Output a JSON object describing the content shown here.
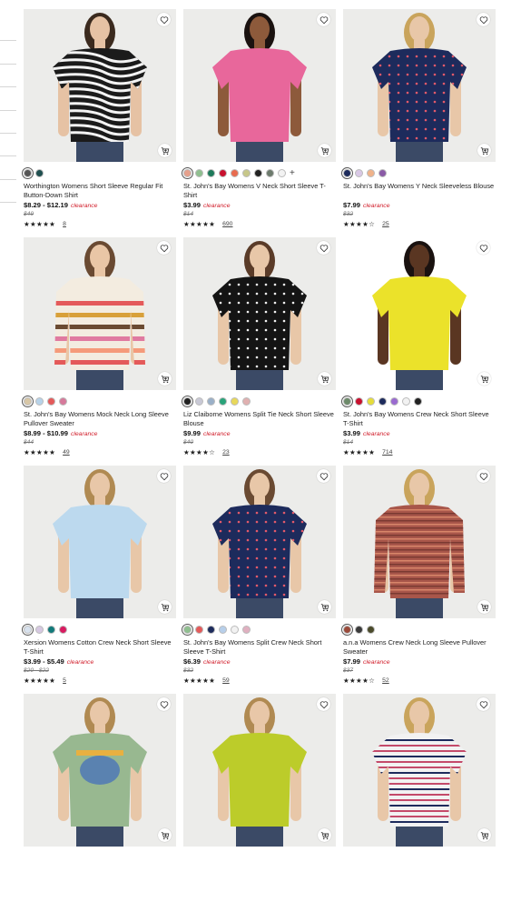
{
  "products": [
    {
      "title": "Worthington Womens Short Sleeve Regular Fit Button-Down Shirt",
      "price": "$8.29 - $12.19",
      "price_label": "clearance",
      "original_price": "$49",
      "reviews": "8",
      "rating": 4.5,
      "swatches": [
        "#555555",
        "#1f4f4f"
      ],
      "image": {
        "bg": "#ececea",
        "garment": "#1b1b1b",
        "pattern": "zebra",
        "skin": "#e6c2a4",
        "hair": "#3b2a1e"
      }
    },
    {
      "title": "St. John's Bay Womens V Neck Short Sleeve T-Shirt",
      "price": "$3.99",
      "price_label": "clearance",
      "original_price": "$14",
      "reviews": "690",
      "rating": 4.5,
      "swatches": [
        "#e6a08c",
        "#8fbf8f",
        "#1e7a5a",
        "#c8102e",
        "#e86b4f",
        "#c7c789",
        "#222222",
        "#6d7b6d",
        "#f2f2f2"
      ],
      "more_swatches": "+",
      "image": {
        "bg": "#ececea",
        "garment": "#e8679b",
        "pattern": "solid",
        "skin": "#8d5a3b",
        "hair": "#1a1210"
      }
    },
    {
      "title": "St. John's Bay Womens Y Neck Sleeveless Blouse",
      "price": "$7.99",
      "price_label": "clearance",
      "original_price": "$32",
      "reviews": "25",
      "rating": 4,
      "swatches": [
        "#1d2b5c",
        "#d9c8e6",
        "#f0b38a",
        "#8a5aa6"
      ],
      "image": {
        "bg": "#ececea",
        "garment": "#1d2b5c",
        "pattern": "dots",
        "skin": "#e8c7a8",
        "hair": "#c9a45c"
      }
    },
    {
      "title": "St. John's Bay Womens Mock Neck Long Sleeve Pullover Sweater",
      "price": "$8.99 - $10.99",
      "price_label": "clearance",
      "original_price": "$44",
      "reviews": "49",
      "rating": 4.5,
      "swatches": [
        "#d8c7a6",
        "#b7d3ea",
        "#e45a5a",
        "#d67a9b"
      ],
      "image": {
        "bg": "#ececea",
        "garment": "#f3ece0",
        "pattern": "stripes",
        "skin": "#e9c6a6",
        "hair": "#6a4a32"
      }
    },
    {
      "title": "Liz Claiborne Womens Split Tie Neck Short Sleeve Blouse",
      "price": "$9.99",
      "price_label": "clearance",
      "original_price": "$40",
      "reviews": "23",
      "rating": 4,
      "swatches": [
        "#222222",
        "#c9c9d6",
        "#9ab0c8",
        "#2aa37a",
        "#e8d85a",
        "#e0b0b0"
      ],
      "image": {
        "bg": "#ececea",
        "garment": "#141414",
        "pattern": "dots-white",
        "skin": "#e8c7a8",
        "hair": "#5a3b28"
      }
    },
    {
      "title": "St. John's Bay Womens Crew Neck Short Sleeve T-Shirt",
      "price": "$3.99",
      "price_label": "clearance",
      "original_price": "$14",
      "reviews": "714",
      "rating": 4.5,
      "swatches": [
        "#6d8a6a",
        "#c8102e",
        "#e6dd3a",
        "#1d2b5c",
        "#9a6ad0",
        "#f2f2f2",
        "#222222"
      ],
      "image": {
        "bg": "#ffffff",
        "garment": "#ebe22a",
        "pattern": "solid",
        "skin": "#5a3622",
        "hair": "#1a1210"
      }
    },
    {
      "title": "Xersion Womens Cotton Crew Neck Short Sleeve T-Shirt",
      "price": "$3.99 - $5.49",
      "price_label": "clearance",
      "original_price": "$20 - $22",
      "reviews": "5",
      "rating": 5,
      "swatches": [
        "#d8e2ee",
        "#d6c8e2",
        "#117a7a",
        "#d81b60"
      ],
      "image": {
        "bg": "#ececea",
        "garment": "#bcd9ee",
        "pattern": "solid",
        "skin": "#e8c7a8",
        "hair": "#b08a52"
      }
    },
    {
      "title": "St. John's Bay Womens Split Crew Neck Short Sleeve T-Shirt",
      "price": "$6.39",
      "price_label": "clearance",
      "original_price": "$32",
      "reviews": "59",
      "rating": 4.5,
      "swatches": [
        "#8fbf8f",
        "#e45a5a",
        "#1d2b5c",
        "#b7cfea",
        "#f2f2f2",
        "#e0b0c0"
      ],
      "image": {
        "bg": "#ececea",
        "garment": "#1d2b5c",
        "pattern": "dots",
        "skin": "#e8c7a8",
        "hair": "#6a4a32"
      }
    },
    {
      "title": "a.n.a Womens Crew Neck Long Sleeve Pullover Sweater",
      "price": "$7.99",
      "price_label": "clearance",
      "original_price": "$37",
      "reviews": "52",
      "rating": 4,
      "swatches": [
        "#9a4a3a",
        "#3a3a3a",
        "#4a4a2a"
      ],
      "image": {
        "bg": "#ececea",
        "garment": "#a8564a",
        "pattern": "knit",
        "skin": "#e8c7a8",
        "hair": "#c9a45c"
      }
    },
    {
      "title": "",
      "price": "",
      "price_label": "",
      "original_price": "",
      "reviews": "",
      "rating": 0,
      "swatches": [],
      "image": {
        "bg": "#ececea",
        "garment": "#98b890",
        "pattern": "graphic",
        "skin": "#e8c7a8",
        "hair": "#b08a52"
      }
    },
    {
      "title": "",
      "price": "",
      "price_label": "",
      "original_price": "",
      "reviews": "",
      "rating": 0,
      "swatches": [],
      "image": {
        "bg": "#ececea",
        "garment": "#bccc2a",
        "pattern": "solid",
        "skin": "#e8c7a8",
        "hair": "#b08a52"
      }
    },
    {
      "title": "",
      "price": "",
      "price_label": "",
      "original_price": "",
      "reviews": "",
      "rating": 0,
      "swatches": [],
      "image": {
        "bg": "#ececea",
        "garment": "#f2f2f2",
        "pattern": "thin-stripes",
        "skin": "#e8c7a8",
        "hair": "#c9a45c"
      }
    }
  ],
  "icons": {
    "wishlist": "heart-icon",
    "cart": "add-to-cart-icon"
  }
}
